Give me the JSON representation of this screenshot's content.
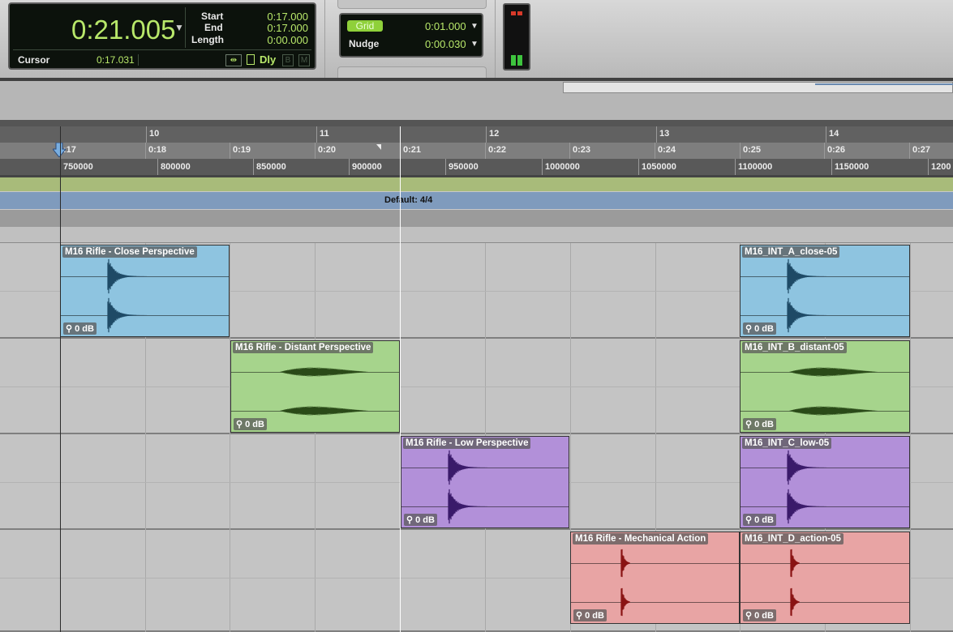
{
  "counter": {
    "main_time": "0:21.005",
    "start_label": "Start",
    "end_label": "End",
    "length_label": "Length",
    "start_value": "0:17.000",
    "end_value": "0:17.000",
    "length_value": "0:00.000",
    "cursor_label": "Cursor",
    "cursor_value": "0:17.031",
    "dly_label": "Dly",
    "b_label": "B",
    "m_label": "M"
  },
  "grid_nudge": {
    "grid_label": "Grid",
    "grid_value": "0:01.000",
    "nudge_label": "Nudge",
    "nudge_value": "0:00.030"
  },
  "rulers": {
    "bars": [
      "10",
      "11",
      "12",
      "13",
      "14"
    ],
    "minsecs": [
      ":17",
      "0:18",
      "0:19",
      "0:20",
      "0:21",
      "0:22",
      "0:23",
      "0:24",
      "0:25",
      "0:26",
      "0:27"
    ],
    "samples": [
      "750000",
      "800000",
      "850000",
      "900000",
      "950000",
      "1000000",
      "1050000",
      "1100000",
      "1150000",
      "1200"
    ],
    "meter": "Default: 4/4"
  },
  "tracks": [
    {
      "color": "#8ec4e0",
      "wave": "#1e4a66",
      "clips": [
        {
          "name": "M16 Rifle - Close Perspective",
          "gain": "0 dB"
        },
        {
          "name": "M16_INT_A_close-05",
          "gain": "0 dB"
        }
      ]
    },
    {
      "color": "#a6d48c",
      "wave": "#2a4a18",
      "clips": [
        {
          "name": "M16 Rifle - Distant Perspective",
          "gain": "0 dB"
        },
        {
          "name": "M16_INT_B_distant-05",
          "gain": "0 dB"
        }
      ]
    },
    {
      "color": "#b290d9",
      "wave": "#3a1a6a",
      "clips": [
        {
          "name": "M16 Rifle - Low Perspective",
          "gain": "0 dB"
        },
        {
          "name": "M16_INT_C_low-05",
          "gain": "0 dB"
        }
      ]
    },
    {
      "color": "#e8a4a4",
      "wave": "#8a1414",
      "clips": [
        {
          "name": "M16 Rifle - Mechanical Action",
          "gain": "0 dB"
        },
        {
          "name": "M16_INT_D_action-05",
          "gain": "0 dB"
        }
      ]
    }
  ]
}
